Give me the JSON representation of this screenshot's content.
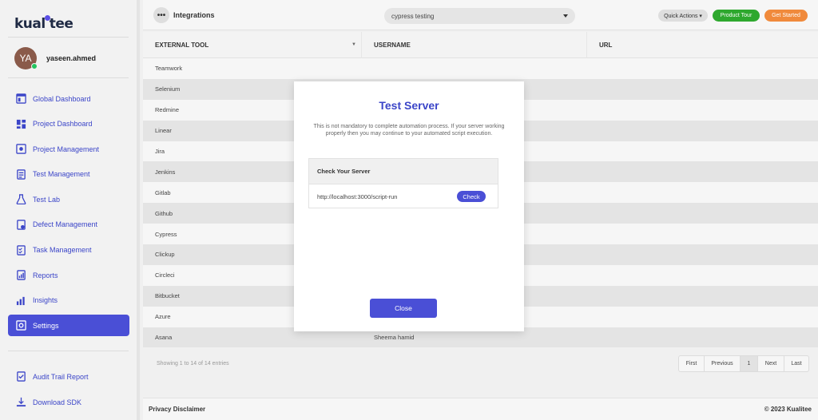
{
  "brand": {
    "logo_left": "kual",
    "logo_right": "tee"
  },
  "user": {
    "initials": "YA",
    "name": "yaseen.ahmed"
  },
  "nav": [
    {
      "label": "Global Dashboard",
      "icon": "global-dashboard-icon",
      "active": false
    },
    {
      "label": "Project Dashboard",
      "icon": "project-dashboard-icon",
      "active": false
    },
    {
      "label": "Project Management",
      "icon": "project-management-icon",
      "active": false
    },
    {
      "label": "Test Management",
      "icon": "test-management-icon",
      "active": false
    },
    {
      "label": "Test Lab",
      "icon": "flask-icon",
      "active": false
    },
    {
      "label": "Defect Management",
      "icon": "defect-icon",
      "active": false
    },
    {
      "label": "Task Management",
      "icon": "task-icon",
      "active": false
    },
    {
      "label": "Reports",
      "icon": "reports-icon",
      "active": false
    },
    {
      "label": "Insights",
      "icon": "insights-icon",
      "active": false
    },
    {
      "label": "Settings",
      "icon": "settings-icon",
      "active": true
    }
  ],
  "nav_bottom": [
    {
      "label": "Audit Trail Report",
      "icon": "audit-icon"
    },
    {
      "label": "Download SDK",
      "icon": "download-icon"
    }
  ],
  "topbar": {
    "menu": "•••",
    "title": "Integrations",
    "project": "cypress testing",
    "quick_actions": "Quick Actions ▾",
    "product_tour": "Product Tour",
    "get_started": "Get Started"
  },
  "table": {
    "headers": [
      "EXTERNAL TOOL",
      "USERNAME",
      "URL"
    ],
    "sort_glyph": "▼",
    "rows": [
      [
        "Teamwork",
        "",
        ""
      ],
      [
        "Selenium",
        "",
        ""
      ],
      [
        "Redmine",
        "",
        ""
      ],
      [
        "Linear",
        "",
        ""
      ],
      [
        "Jira",
        "",
        ""
      ],
      [
        "Jenkins",
        "",
        ""
      ],
      [
        "Gitlab",
        "",
        ""
      ],
      [
        "Github",
        "",
        ""
      ],
      [
        "Cypress",
        "",
        ""
      ],
      [
        "Clickup",
        "",
        ""
      ],
      [
        "Circleci",
        "",
        ""
      ],
      [
        "Bitbucket",
        "",
        ""
      ],
      [
        "Azure",
        "",
        ""
      ],
      [
        "Asana",
        "Sheema hamid",
        ""
      ]
    ],
    "entries": "Showing 1 to 14 of 14 entries"
  },
  "pager": {
    "first": "First",
    "prev": "Previous",
    "page": "1",
    "next": "Next",
    "last": "Last"
  },
  "footer": {
    "left": "Privacy Disclaimer",
    "right": "© 2023 Kualitee"
  },
  "modal": {
    "title": "Test Server",
    "description": "This is not mandatory to complete automation process. If your server working properly then you may continue to your automated script execution.",
    "box_title": "Check Your Server",
    "server_url": "http://localhost:3000/script-run",
    "check": "Check",
    "close": "Close"
  },
  "colors": {
    "accent": "#4a4fd6",
    "green": "#2ea82e",
    "orange": "#f08a3c",
    "nav_text": "#3b45c8"
  }
}
